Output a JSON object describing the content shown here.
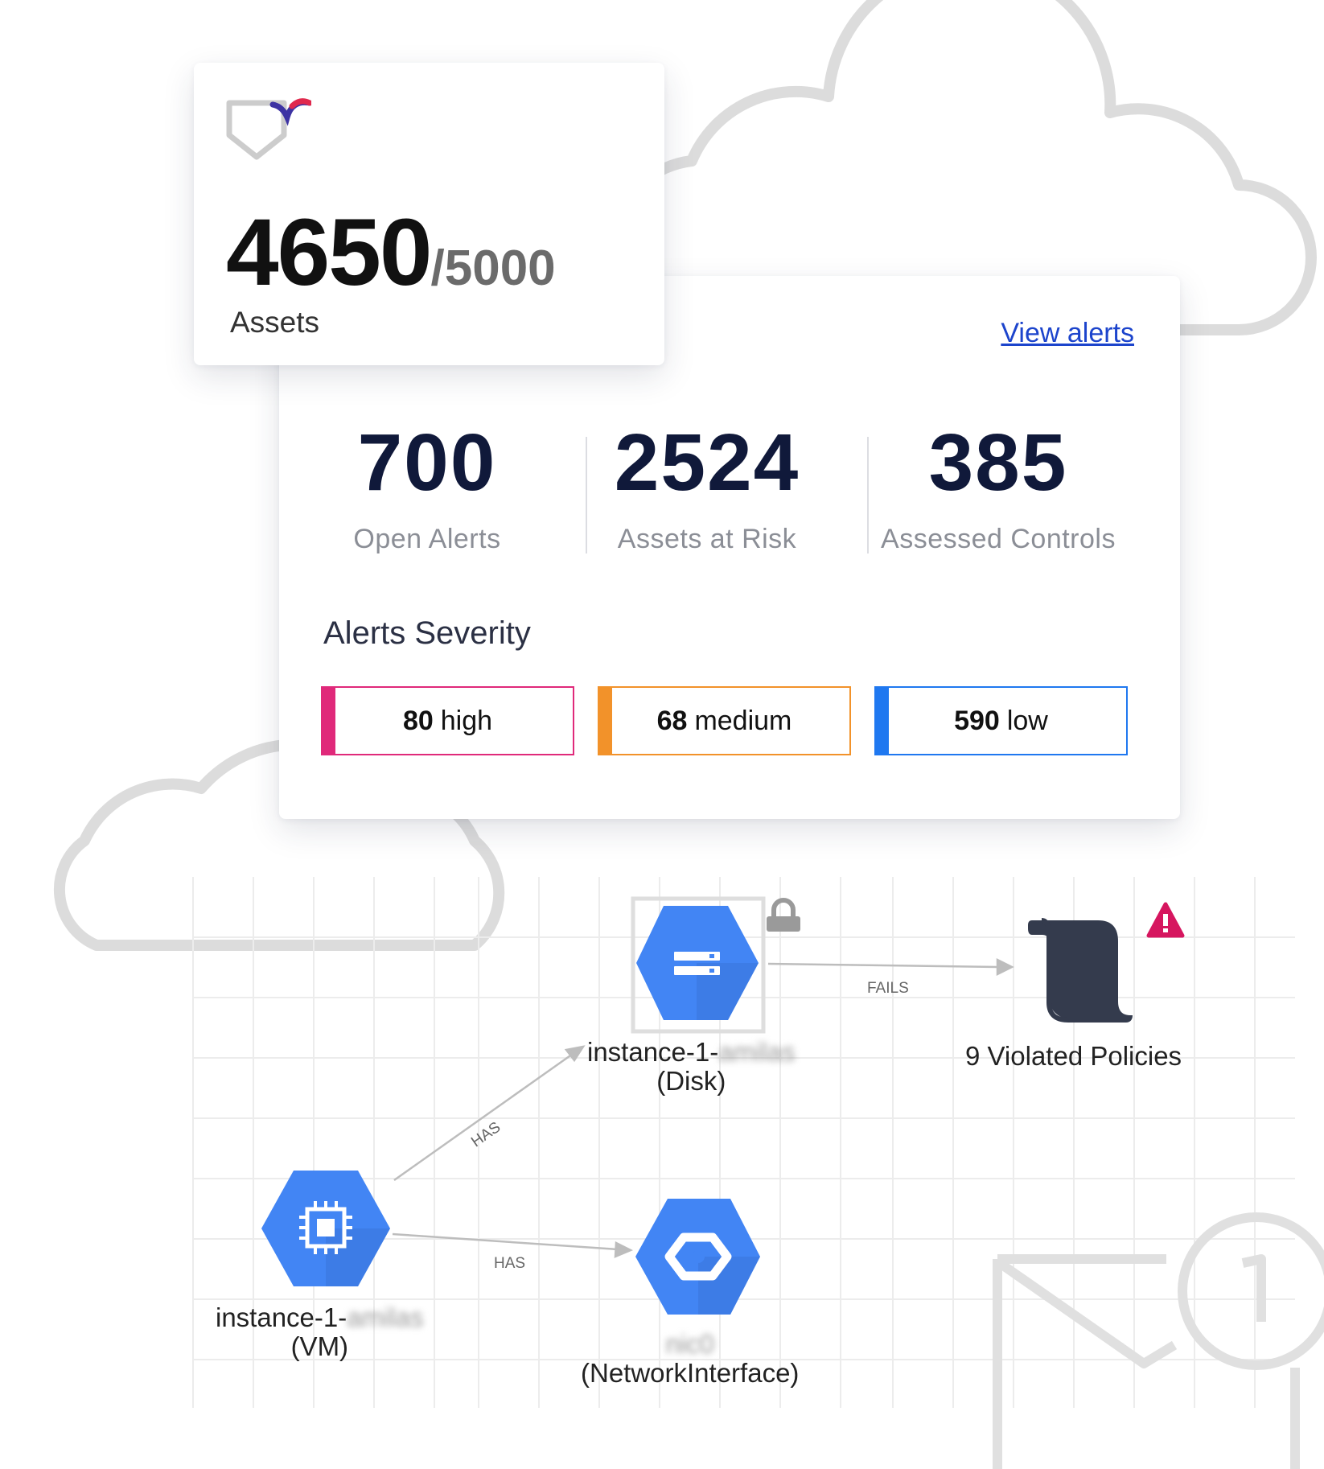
{
  "assets_card": {
    "count": "4650",
    "total": "/5000",
    "label": "Assets"
  },
  "alerts_card": {
    "view_alerts_link": "View alerts",
    "stats": [
      {
        "value": "700",
        "label": "Open Alerts"
      },
      {
        "value": "2524",
        "label": "Assets at Risk"
      },
      {
        "value": "385",
        "label": "Assessed Controls"
      }
    ],
    "severity_title": "Alerts Severity",
    "severity": [
      {
        "count": "80",
        "level": "high",
        "color": "#e0297a"
      },
      {
        "count": "68",
        "level": "medium",
        "color": "#f2922a"
      },
      {
        "count": "590",
        "level": "low",
        "color": "#1f78f0"
      }
    ]
  },
  "graph": {
    "nodes": {
      "disk": {
        "name_prefix": "instance-1-",
        "name_hidden": "amilas",
        "type": "(Disk)",
        "icon": "storage-icon",
        "badge_icon": "lock-icon"
      },
      "vm": {
        "name_prefix": "instance-1-",
        "name_hidden": "amilas",
        "type": "(VM)",
        "icon": "cpu-chip-icon"
      },
      "nic": {
        "name_hidden": "nic0",
        "type": "(NetworkInterface)",
        "icon": "network-hexagon-icon"
      },
      "policies": {
        "label": "9 Violated Policies",
        "icon": "policy-scroll-icon",
        "badge_icon": "warning-icon"
      }
    },
    "edges": [
      {
        "label": "HAS",
        "from": "vm",
        "to": "disk"
      },
      {
        "label": "HAS",
        "from": "vm",
        "to": "nic"
      },
      {
        "label": "FAILS",
        "from": "disk",
        "to": "policies"
      }
    ]
  },
  "notification": {
    "count": "1",
    "icon": "mail-icon"
  },
  "colors": {
    "gcp_blue": "#4285f4",
    "dark_navy": "#10193a",
    "link_blue": "#1c44cc",
    "warning_magenta": "#d6165f"
  }
}
